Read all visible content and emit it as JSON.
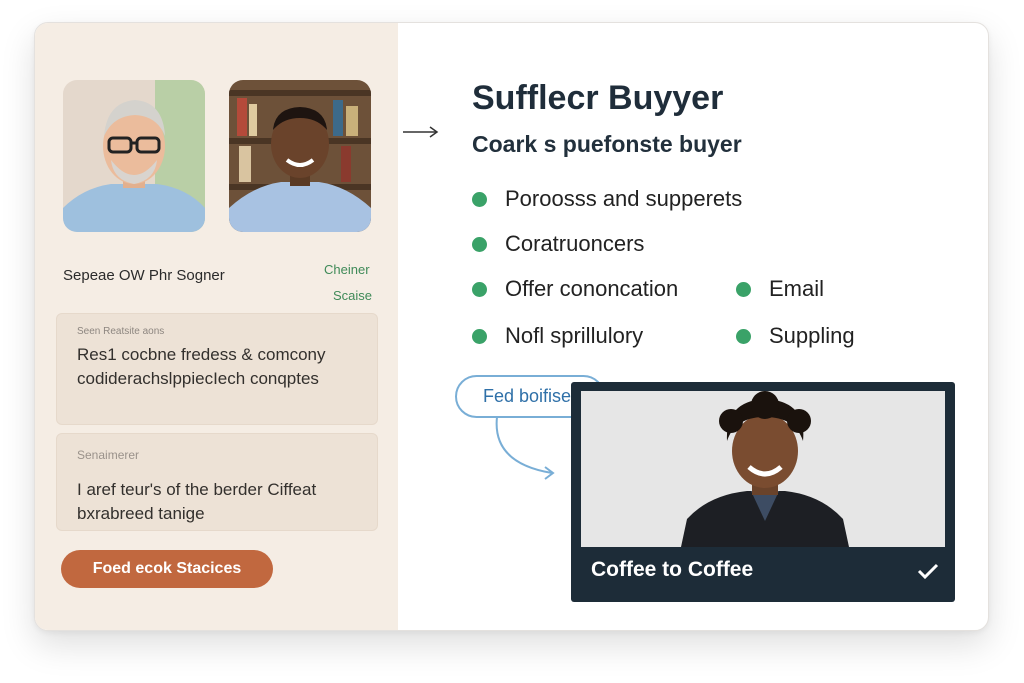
{
  "profile": {
    "name": "Sepeae OW Phr Sogner",
    "tag_top": "Cheiner",
    "tag_bottom": "Scaise",
    "box1": {
      "label": "Seen Reatsite aons",
      "text": "Res1 cocbne fredess & comcony codiderachslppiecIech conqptes"
    },
    "box2": {
      "label": "Senaimerer",
      "text": "I aref teur's of the berder Ciffeat bxrabreed tanige"
    },
    "cta_label": "Foed ecok Stacices"
  },
  "main": {
    "title": "Sufflecr Buyyer",
    "subtitle": "Coark s puefonste buyer",
    "bullets": [
      "Poroosss and supperets",
      "Coratruoncers",
      "Offer cononcation",
      "Email",
      "Nofl sprillulory",
      "Suppling"
    ]
  },
  "callout": {
    "label": "Fed boifiser"
  },
  "video": {
    "caption": "Coffee to Coffee"
  },
  "colors": {
    "accent_green": "#3aa268",
    "cta_orange": "#c1683f",
    "video_bg": "#1d2c38",
    "pill_border": "#79aed6"
  },
  "icons": [
    "arrow-right-icon",
    "curved-arrow-icon",
    "check-icon"
  ]
}
